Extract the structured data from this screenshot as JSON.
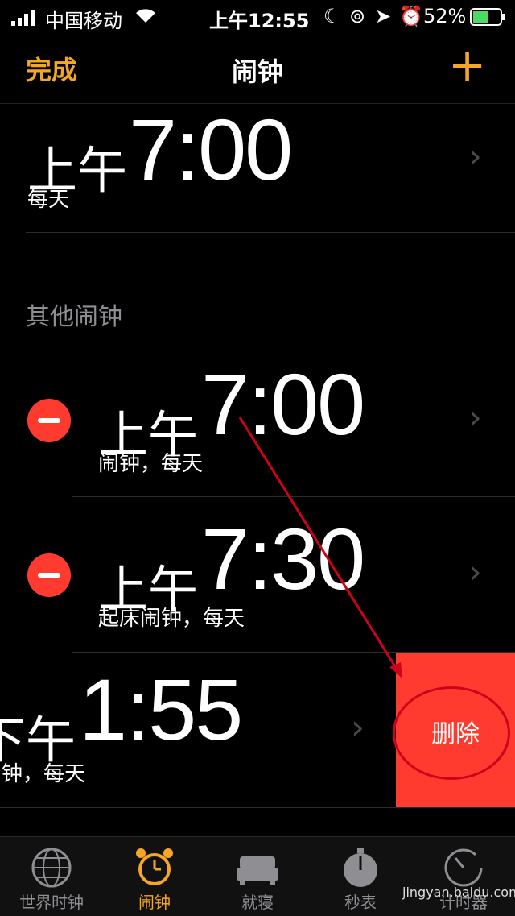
{
  "status_bar": {
    "carrier": "中国移动",
    "time": "上午12:55",
    "battery": "52%"
  },
  "nav": {
    "left": "完成",
    "title": "闹钟",
    "right": "+"
  },
  "main": {
    "alarm_top": {
      "ampm": "上午",
      "time": "7:00",
      "label": "每天"
    },
    "section_title": "其他闹钟",
    "alarms": [
      {
        "ampm": "上午",
        "time": "7:00",
        "label": "闹钟，每天"
      },
      {
        "ampm": "上午",
        "time": "7:30",
        "label": "起床闹钟，每天"
      },
      {
        "ampm": "下午",
        "time": "1:55",
        "label": "钟，每天"
      }
    ],
    "delete_label": "删除"
  },
  "tabs": [
    {
      "label": "世界时钟",
      "icon": "globe-icon"
    },
    {
      "label": "闹钟",
      "icon": "alarm-clock-icon",
      "active": true
    },
    {
      "label": "就寝",
      "icon": "bed-icon"
    },
    {
      "label": "秒表",
      "icon": "stopwatch-icon"
    },
    {
      "label": "计时器",
      "icon": "timer-icon"
    }
  ],
  "watermark": "jingyan.baidu.com",
  "colors": {
    "accent": "#f5a623",
    "delete": "#ff3b30"
  }
}
